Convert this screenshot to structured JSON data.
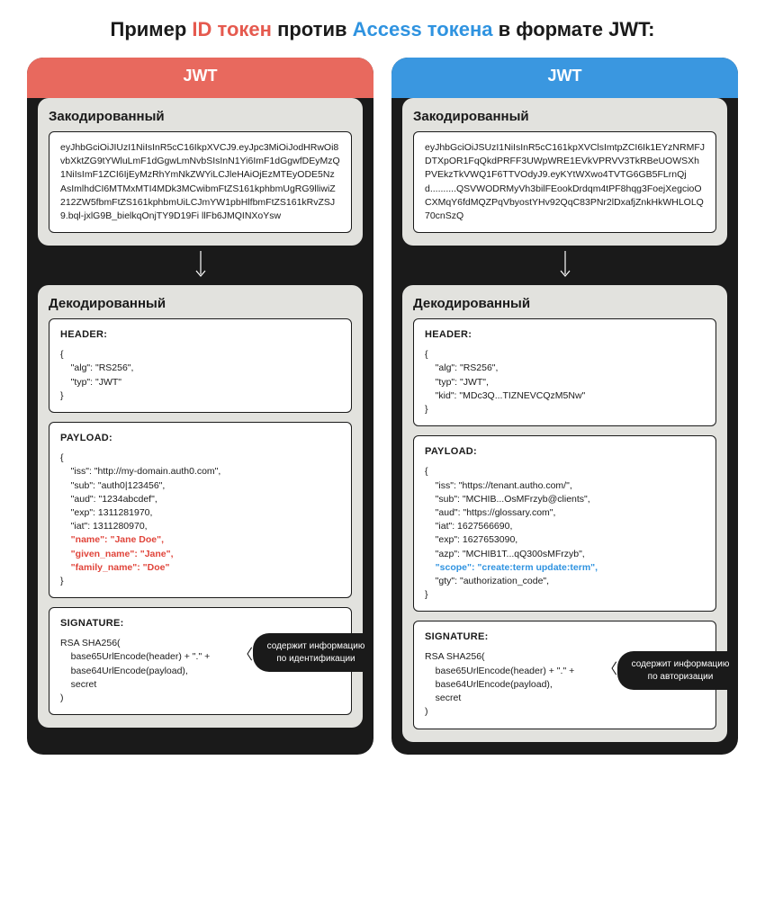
{
  "title": {
    "pre": "Пример ",
    "red": "ID токен",
    "mid": " против ",
    "blue": "Access токена",
    "post": " в формате JWT:"
  },
  "left": {
    "header": "JWT",
    "encoded_title": "Закодированный",
    "encoded_text": "eyJhbGciOiJIUzI1NiIsInR5cC16IkpXVCJ9.eyJpc3MiOiJodHRwOi8vbXktZG9tYWluLmF1dGgwLmNvbSIsInN1Yi6ImF1dGgwfDEyMzQ1NiIsImF1ZCI6IjEyMzRhYmNkZWYiLCJleHAiOjEzMTEyODE5NzAsImlhdCI6MTMxMTI4MDk3MCwibmFtZS161kphbmUgRG9lliwiZ212ZW5fbmFtZS161kphbmUiLCJmYW1pbHlfbmFtZS161kRvZSJ9.bql-jxlG9B_bielkqOnjTY9D19Fi llFb6JMQINXoYsw",
    "decoded_title": "Декодированный",
    "header_label": "HEADER:",
    "header_code": "{\n    \"alg\": \"RS256\",\n    \"typ\": \"JWT\"\n}",
    "payload_label": "PAYLOAD:",
    "payload_code_pre": "{\n    \"iss\": \"http://my-domain.auth0.com\",\n    \"sub\": \"auth0|123456\",\n    \"aud\": \"1234abcdef\",\n    \"exp\": 1311281970,\n    \"iat\": 1311280970,\n",
    "payload_hl1": "    \"name\": \"Jane Doe\",",
    "payload_hl2": "    \"given_name\": \"Jane\",",
    "payload_hl3": "    \"family_name\": \"Doe\"",
    "payload_code_post": "\n}",
    "signature_label": "SIGNATURE:",
    "signature_code": "RSA SHA256(\n    base65UrlEncode(header) + \".\" +\n    base64UrlEncode(payload),\n    secret\n)",
    "callout": "содержит информацию по идентификации"
  },
  "right": {
    "header": "JWT",
    "encoded_title": "Закодированный",
    "encoded_text": "eyJhbGciOiJSUzI1NiIsInR5cC161kpXVClsImtpZCI6Ik1EYzNRMFJDTXpOR1FqQkdPRFF3UWpWRE1EVkVPRVV3TkRBeUOWSXhPVEkzTkVWQ1F6TTVOdyJ9.eyKYtWXwo4TVTG6GB5FLrnQjd..........QSVWODRMyVh3bilFEookDrdqm4tPF8hqg3FoejXegcioOCXMqY6fdMQZPqVbyostYHv92QqC83PNr2lDxafjZnkHkWHLOLQ70cnSzQ",
    "decoded_title": "Декодированный",
    "header_label": "HEADER:",
    "header_code": "{\n    \"alg\": \"RS256\",\n    \"typ\": \"JWT\",\n    \"kid\": \"MDc3Q...TIZNEVCQzM5Nw\"\n}",
    "payload_label": "PAYLOAD:",
    "payload_code_pre": "{\n    \"iss\": \"https://tenant.autho.com/\",\n    \"sub\": \"MCHIB...OsMFrzyb@clients\",\n    \"aud\": \"https://glossary.com\",\n    \"iat\": 1627566690,\n    \"exp\": 1627653090,\n    \"azp\": \"MCHIB1T...qQ300sMFrzyb\",\n",
    "payload_hl1": "    \"scope\": \"create:term update:term\",",
    "payload_code_post": "\n    \"gty\": \"authorization_code\",\n}",
    "signature_label": "SIGNATURE:",
    "signature_code": "RSA SHA256(\n    base65UrlEncode(header) + \".\" +\n    base64UrlEncode(payload),\n    secret\n)",
    "callout": "содержит информацию по авторизации"
  }
}
